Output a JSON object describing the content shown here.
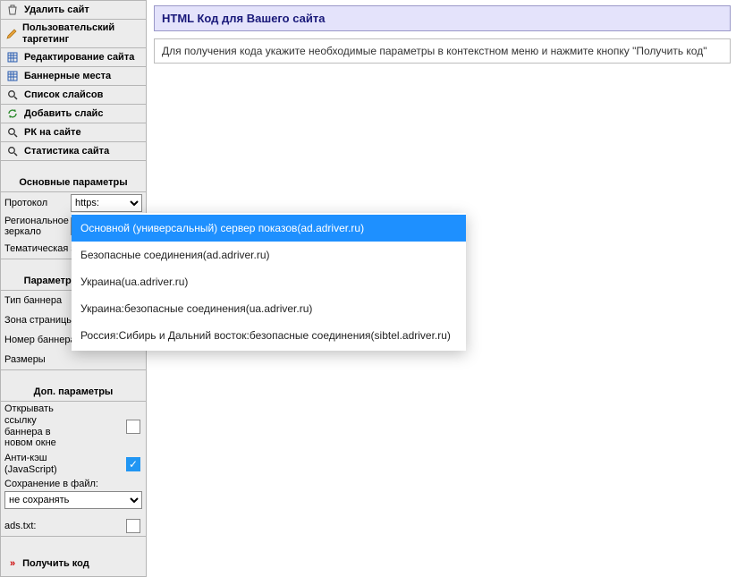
{
  "sidebar": {
    "items": [
      {
        "label": "Удалить сайт",
        "icon": "trash"
      },
      {
        "label": "Пользовательский таргетинг",
        "icon": "pencil"
      },
      {
        "label": "Редактирование сайта",
        "icon": "grid"
      },
      {
        "label": "Баннерные места",
        "icon": "grid"
      },
      {
        "label": "Список слайсов",
        "icon": "search"
      },
      {
        "label": "Добавить слайс",
        "icon": "refresh"
      },
      {
        "label": "РК на сайте",
        "icon": "search"
      },
      {
        "label": "Статистика сайта",
        "icon": "search"
      }
    ]
  },
  "sections": {
    "main_params": "Основные параметры",
    "banner_params": "Параметры баннера",
    "extra_params": "Доп. параметры"
  },
  "main_params": {
    "protocol_label": "Протокол",
    "protocol_value": "https:",
    "mirror_label": "Региональное зеркало",
    "mirror_value": "Основной (",
    "theme_label": "Тематическая зона"
  },
  "banner_params": {
    "type_label": "Тип баннера",
    "zone_label": "Зона страницы",
    "num_label": "Номер баннера на странице",
    "sizes_label": "Размеры"
  },
  "extra_params": {
    "open_new_label": "Открывать ссылку баннера в новом окне",
    "open_new_checked": false,
    "anticache_label": "Анти-кэш (JavaScript)",
    "anticache_checked": true,
    "save_file_label": "Сохранение в файл:",
    "save_file_value": "не сохранять",
    "ads_txt_label": "ads.txt:",
    "ads_txt_checked": false
  },
  "get_code_label": "Получить код",
  "panel": {
    "title": "HTML Код для Вашего сайта",
    "hint": "Для получения кода укажите необходимые параметры в контекстном меню и нажмите кнопку \"Получить код\""
  },
  "dropdown": {
    "options": [
      "Основной (универсальный) сервер показов(ad.adriver.ru)",
      "Безопасные соединения(ad.adriver.ru)",
      "Украина(ua.adriver.ru)",
      "Украина:безопасные соединения(ua.adriver.ru)",
      "Россия:Сибирь и Дальний восток:безопасные соединения(sibtel.adriver.ru)"
    ],
    "selected_index": 0
  }
}
